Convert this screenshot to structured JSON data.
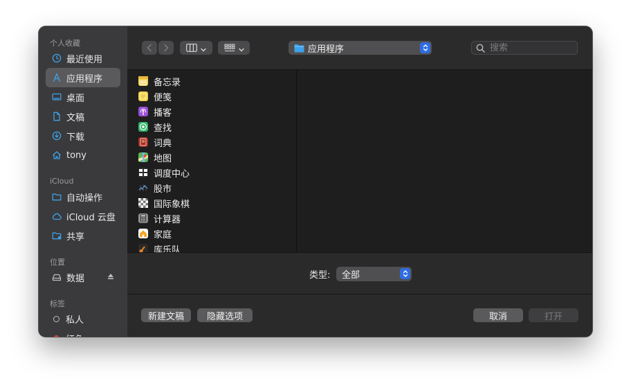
{
  "sidebar": {
    "favorites_header": "个人收藏",
    "favorites": [
      {
        "label": "最近使用",
        "icon": "clock-icon"
      },
      {
        "label": "应用程序",
        "icon": "applications-icon",
        "selected": true
      },
      {
        "label": "桌面",
        "icon": "desktop-icon"
      },
      {
        "label": "文稿",
        "icon": "document-icon"
      },
      {
        "label": "下载",
        "icon": "download-icon"
      },
      {
        "label": "tony",
        "icon": "home-icon"
      }
    ],
    "icloud_header": "iCloud",
    "icloud": [
      {
        "label": "自动操作",
        "icon": "folder-icon"
      },
      {
        "label": "iCloud 云盘",
        "icon": "cloud-icon"
      },
      {
        "label": "共享",
        "icon": "shared-folder-icon"
      }
    ],
    "locations_header": "位置",
    "locations": [
      {
        "label": "数据",
        "icon": "drive-icon"
      }
    ],
    "tags_header": "标签",
    "tags": [
      {
        "label": "私人",
        "color": "#bdbdbd"
      },
      {
        "label": "红色",
        "color": "#e84b3c"
      }
    ]
  },
  "toolbar": {
    "path_label": "应用程序",
    "search_placeholder": "搜索"
  },
  "files": [
    {
      "name": "备忘录",
      "icon": "notes-icon",
      "color": "#f4d35e"
    },
    {
      "name": "便笺",
      "icon": "stickies-icon",
      "color": "#f2d04b"
    },
    {
      "name": "播客",
      "icon": "podcasts-icon",
      "color": "#9b4fd6"
    },
    {
      "name": "查找",
      "icon": "find-my-icon",
      "color": "#34b36b"
    },
    {
      "name": "词典",
      "icon": "dictionary-icon",
      "color": "#a52a2a"
    },
    {
      "name": "地图",
      "icon": "maps-icon",
      "color": "#5fb55c"
    },
    {
      "name": "调度中心",
      "icon": "mission-control-icon",
      "color": "#2d2d2d"
    },
    {
      "name": "股市",
      "icon": "stocks-icon",
      "color": "#1c1c1e"
    },
    {
      "name": "国际象棋",
      "icon": "chess-icon",
      "color": "#7a7a7a"
    },
    {
      "name": "计算器",
      "icon": "calculator-icon",
      "color": "#8e8e93"
    },
    {
      "name": "家庭",
      "icon": "home-app-icon",
      "color": "#f5a623"
    },
    {
      "name": "库乐队",
      "icon": "garageband-icon",
      "color": "#e6822b"
    }
  ],
  "options": {
    "type_label": "类型:",
    "type_value": "全部"
  },
  "buttons": {
    "new_document": "新建文稿",
    "hide_options": "隐藏选项",
    "cancel": "取消",
    "open": "打开"
  },
  "colors": {
    "accent": "#2f6de1",
    "folder": "#3ea2e8"
  }
}
